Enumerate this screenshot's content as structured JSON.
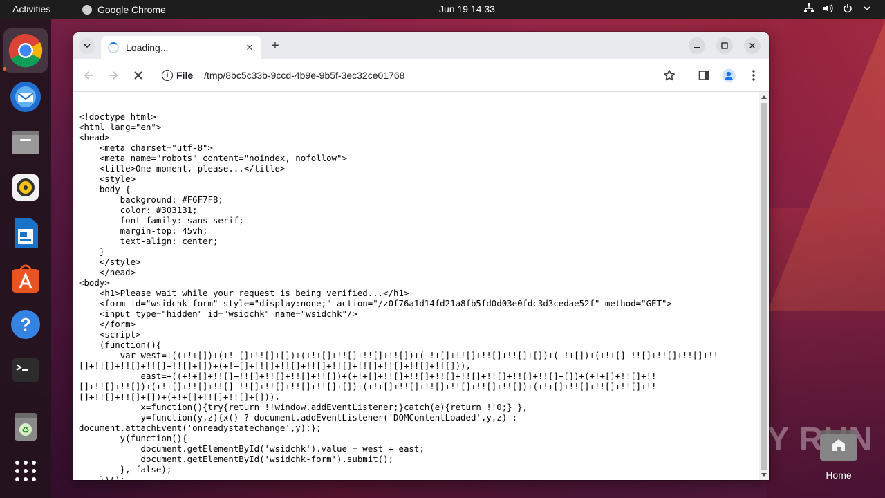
{
  "topbar": {
    "activities": "Activities",
    "app_name": "Google Chrome",
    "clock": "Jun 19  14:33"
  },
  "dock": {
    "items": [
      "chrome",
      "thunderbird",
      "files",
      "rhythmbox",
      "libreoffice-writer",
      "app-center",
      "help",
      "terminal",
      "trash",
      "show-apps"
    ]
  },
  "browser": {
    "tab_title": "Loading...",
    "scheme_label": "File",
    "url": "/tmp/8bc5c33b-9ccd-4b9e-9b5f-3ec32ce01768"
  },
  "page_source": "<!doctype html>\n<html lang=\"en\">\n<head>\n    <meta charset=\"utf-8\">\n    <meta name=\"robots\" content=\"noindex, nofollow\">\n    <title>One moment, please...</title>\n    <style>\n    body {\n        background: #F6F7F8;\n        color: #303131;\n        font-family: sans-serif;\n        margin-top: 45vh;\n        text-align: center;\n    }\n    </style>\n    </head>\n<body>\n    <h1>Please wait while your request is being verified...</h1>\n    <form id=\"wsidchk-form\" style=\"display:none;\" action=\"/z0f76a1d14fd21a8fb5fd0d03e0fdc3d3cedae52f\" method=\"GET\">\n    <input type=\"hidden\" id=\"wsidchk\" name=\"wsidchk\"/>\n    </form>\n    <script>\n    (function(){\n        var west=+((+!+[])+(+!+[]+!![]+[])+(+!+[]+!![]+!![]+!![])+(+!+[]+!![]+!![]+!![]+[])+(+!+[])+(+!+[]+!![]+!![]+!![]+!!\n[]+!![]+!![]+!![]+!![]+[])+(+!+[]+!![]+!![]+!![]+!![]+!![]+!![]+!![]+!![])),\n            east=+((+!+[]+!![]+!![]+!![]+!![]+!![])+(+!+[]+!![]+!![]+!![]+!![]+!![]+!![]+!![]+[])+(+!+[]+!![]+!!\n[]+!![]+!![])+(+!+[]+!![]+!![]+!![]+!![]+!![]+!![]+[])+(+!+[]+!![]+!![]+!![]+!![]+!![])+(+!+[]+!![]+!![]+!![]+!!\n[]+!![]+!![]+[])+(+!+[]+!![]+!![]+[])),\n            x=function(){try{return !!window.addEventListener;}catch(e){return !!0;} },\n            y=function(y,z){x() ? document.addEventListener('DOMContentLoaded',y,z) :\ndocument.attachEvent('onreadystatechange',y);};\n        y(function(){\n            document.getElementById('wsidchk').value = west + east;\n            document.getElementById('wsidchk-form').submit();\n        }, false);\n    })();",
  "desktop": {
    "home_label": "Home",
    "watermark": "ANY RUN"
  }
}
